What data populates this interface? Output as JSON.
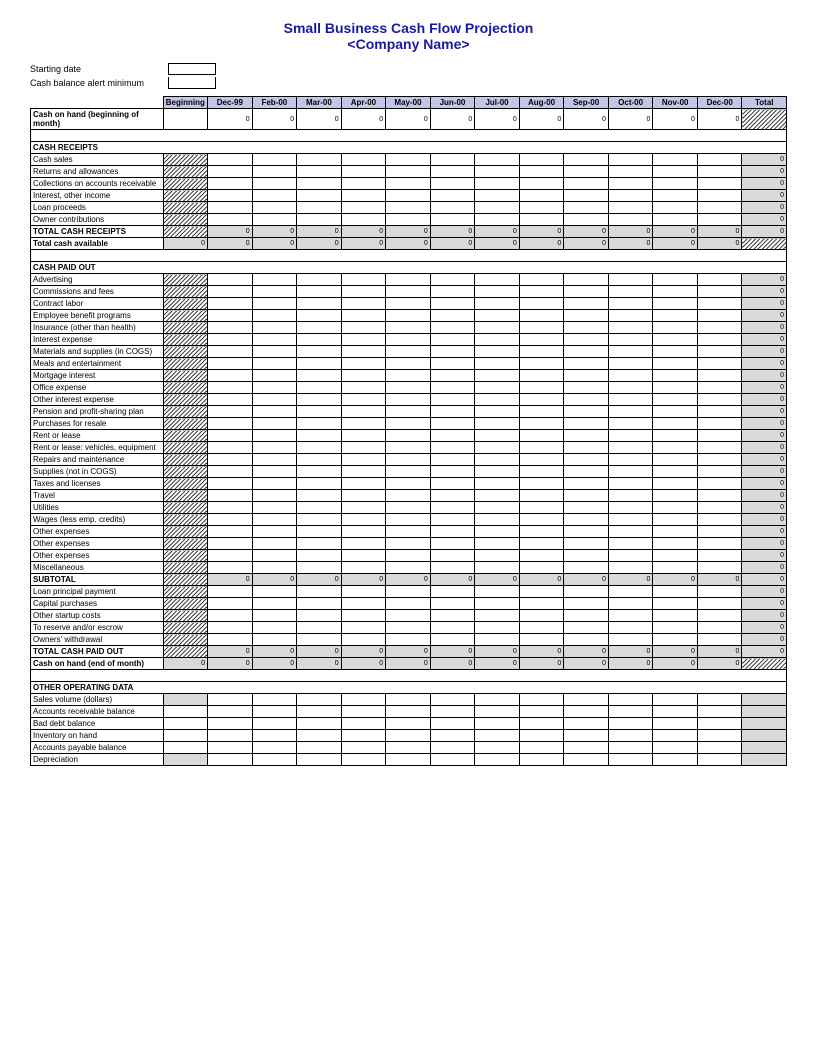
{
  "title": "Small Business Cash Flow Projection",
  "subtitle": "<Company Name>",
  "meta": {
    "starting_date_label": "Starting date",
    "cash_alert_label": "Cash balance alert minimum"
  },
  "columns": [
    "Beginning",
    "Dec-99",
    "Feb-00",
    "Mar-00",
    "Apr-00",
    "May-00",
    "Jun-00",
    "Jul-00",
    "Aug-00",
    "Sep-00",
    "Oct-00",
    "Nov-00",
    "Dec-00",
    "Total"
  ],
  "zero": "0",
  "rows": {
    "cash_on_hand_begin": "Cash on hand (beginning of month)",
    "cash_receipts_header": "CASH RECEIPTS",
    "cash_sales": "Cash sales",
    "returns": "Returns and allowances",
    "collections": "Collections on accounts receivable",
    "interest_income": "Interest, other income",
    "loan_proceeds": "Loan proceeds",
    "owner_contrib": "Owner contributions",
    "total_receipts": "TOTAL CASH RECEIPTS",
    "total_cash_avail": "Total cash available",
    "cash_paid_header": "CASH PAID OUT",
    "advertising": "Advertising",
    "commissions": "Commissions and fees",
    "contract_labor": "Contract labor",
    "emp_benefit": "Employee benefit programs",
    "insurance": "Insurance (other than health)",
    "interest_exp": "Interest expense",
    "materials": "Materials and supplies (in COGS)",
    "meals": "Meals and entertainment",
    "mortgage": "Mortgage interest",
    "office": "Office expense",
    "other_int": "Other interest expense",
    "pension": "Pension and profit-sharing plan",
    "purchases": "Purchases for resale",
    "rent": "Rent or lease",
    "rent_vehicles": "Rent or lease: vehicles, equipment",
    "repairs": "Repairs and maintenance",
    "supplies": "Supplies (not in COGS)",
    "taxes": "Taxes and licenses",
    "travel": "Travel",
    "utilities": "Utilities",
    "wages": "Wages (less emp. credits)",
    "other_exp1": "Other expenses",
    "other_exp2": "Other expenses",
    "other_exp3": "Other expenses",
    "misc": "Miscellaneous",
    "subtotal": "SUBTOTAL",
    "loan_principal": "Loan principal payment",
    "capital": "Capital purchases",
    "startup": "Other startup costs",
    "reserve": "To reserve and/or escrow",
    "own_withdraw": "Owners' withdrawal",
    "total_paid": "TOTAL CASH PAID OUT",
    "cash_end": "Cash on hand (end of month)",
    "other_data_header": "OTHER OPERATING DATA",
    "sales_vol": "Sales volume (dollars)",
    "ar_balance": "Accounts receivable balance",
    "bad_debt": "Bad debt balance",
    "inventory": "Inventory on hand",
    "ap_balance": "Accounts payable balance",
    "depreciation": "Depreciation"
  }
}
